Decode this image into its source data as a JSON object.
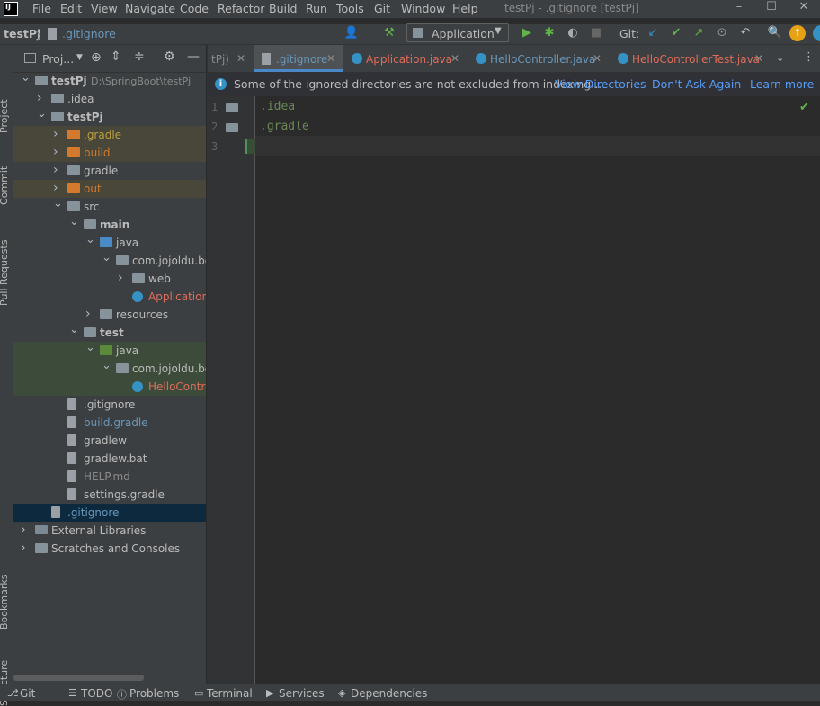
{
  "menubar": {
    "items": [
      "File",
      "Edit",
      "View",
      "Navigate",
      "Code",
      "Refactor",
      "Build",
      "Run",
      "Tools",
      "Git",
      "Window",
      "Help"
    ],
    "title": "testPj - .gitignore [testPj]"
  },
  "navbar": {
    "breadcrumb_project": "testPj",
    "breadcrumb_file": ".gitignore",
    "run_config": "Application",
    "git_label": "Git:"
  },
  "stripe": {
    "project": "Project",
    "commit": "Commit",
    "pull_requests": "Pull Requests",
    "bookmarks": "Bookmarks",
    "structure": "Structure"
  },
  "project_panel": {
    "title": "Proj...",
    "tree": [
      {
        "label": "testPj",
        "extra": "D:\\SpringBoot\\testPj",
        "depth": 0,
        "icon": "folder",
        "arrow": "v",
        "bold": true
      },
      {
        "label": ".idea",
        "depth": 1,
        "icon": "folder",
        "arrow": ">"
      },
      {
        "label": "testPj",
        "depth": 1,
        "icon": "folder",
        "arrow": "v",
        "bold": true
      },
      {
        "label": ".gradle",
        "depth": 2,
        "icon": "folder-orange",
        "arrow": ">",
        "color": "#b9a03a",
        "bg": "#49463a"
      },
      {
        "label": "build",
        "depth": 2,
        "icon": "folder-orange",
        "arrow": ">",
        "color": "#d47a2d",
        "bg": "#49463a"
      },
      {
        "label": "gradle",
        "depth": 2,
        "icon": "folder",
        "arrow": ">"
      },
      {
        "label": "out",
        "depth": 2,
        "icon": "folder-orange",
        "arrow": ">",
        "color": "#d47a2d",
        "bg": "#49463a"
      },
      {
        "label": "src",
        "depth": 2,
        "icon": "folder",
        "arrow": "v"
      },
      {
        "label": "main",
        "depth": 3,
        "icon": "folder",
        "arrow": "v",
        "bold": true
      },
      {
        "label": "java",
        "depth": 4,
        "icon": "folder-blue",
        "arrow": "v"
      },
      {
        "label": "com.jojoldu.bo",
        "depth": 5,
        "icon": "folder",
        "arrow": "v"
      },
      {
        "label": "web",
        "depth": 6,
        "icon": "folder",
        "arrow": ">"
      },
      {
        "label": "Application",
        "depth": 6,
        "icon": "java",
        "arrow": "",
        "color": "#e06c5b"
      },
      {
        "label": "resources",
        "depth": 4,
        "icon": "folder",
        "arrow": ">"
      },
      {
        "label": "test",
        "depth": 3,
        "icon": "folder",
        "arrow": "v",
        "bold": true
      },
      {
        "label": "java",
        "depth": 4,
        "icon": "folder-green",
        "arrow": "v",
        "bg": "#3d4b3a"
      },
      {
        "label": "com.jojoldu.bo",
        "depth": 5,
        "icon": "folder",
        "arrow": "v",
        "bg": "#3d4b3a"
      },
      {
        "label": "HelloContro",
        "depth": 6,
        "icon": "java",
        "arrow": "",
        "color": "#e06c5b",
        "bg": "#3d4b3a"
      },
      {
        "label": ".gitignore",
        "depth": 2,
        "icon": "file",
        "arrow": ""
      },
      {
        "label": "build.gradle",
        "depth": 2,
        "icon": "file",
        "arrow": "",
        "color": "#6897bb"
      },
      {
        "label": "gradlew",
        "depth": 2,
        "icon": "file",
        "arrow": ""
      },
      {
        "label": "gradlew.bat",
        "depth": 2,
        "icon": "file",
        "arrow": ""
      },
      {
        "label": "HELP.md",
        "depth": 2,
        "icon": "file",
        "arrow": "",
        "color": "#8a8a8a"
      },
      {
        "label": "settings.gradle",
        "depth": 2,
        "icon": "file",
        "arrow": ""
      },
      {
        "label": ".gitignore",
        "depth": 1,
        "icon": "file",
        "arrow": "",
        "color": "#6897bb",
        "selected": true
      },
      {
        "label": "External Libraries",
        "depth": 0,
        "icon": "lib",
        "arrow": ">"
      },
      {
        "label": "Scratches and Consoles",
        "depth": 0,
        "icon": "scratch",
        "arrow": ">"
      }
    ]
  },
  "editor_tabs": [
    {
      "label": "tPj)",
      "color": "#8a8a8a",
      "close": true
    },
    {
      "label": ".gitignore",
      "color": "#6897bb",
      "close": true,
      "active": true
    },
    {
      "label": "Application.java",
      "color": "#e06c5b",
      "close": true
    },
    {
      "label": "HelloController.java",
      "color": "#6897bb",
      "close": true
    },
    {
      "label": "HelloControllerTest.java",
      "color": "#e06c5b",
      "close": true
    }
  ],
  "banner": {
    "message": "Some of the ignored directories are not excluded from indexing...",
    "view_directories": "View Directories",
    "dont_ask": "Don't Ask Again",
    "learn_more": "Learn more"
  },
  "code_lines": [
    {
      "num": "1",
      "text": ".idea"
    },
    {
      "num": "2",
      "text": ".gradle"
    },
    {
      "num": "3",
      "text": ""
    }
  ],
  "bottom_tabs": [
    "Git",
    "TODO",
    "Problems",
    "Terminal",
    "Services",
    "Dependencies"
  ],
  "colors": {
    "accent_blue": "#6897bb",
    "error_red": "#e06c5b",
    "bg": "#2b2b2b",
    "panel": "#3c3f41"
  }
}
